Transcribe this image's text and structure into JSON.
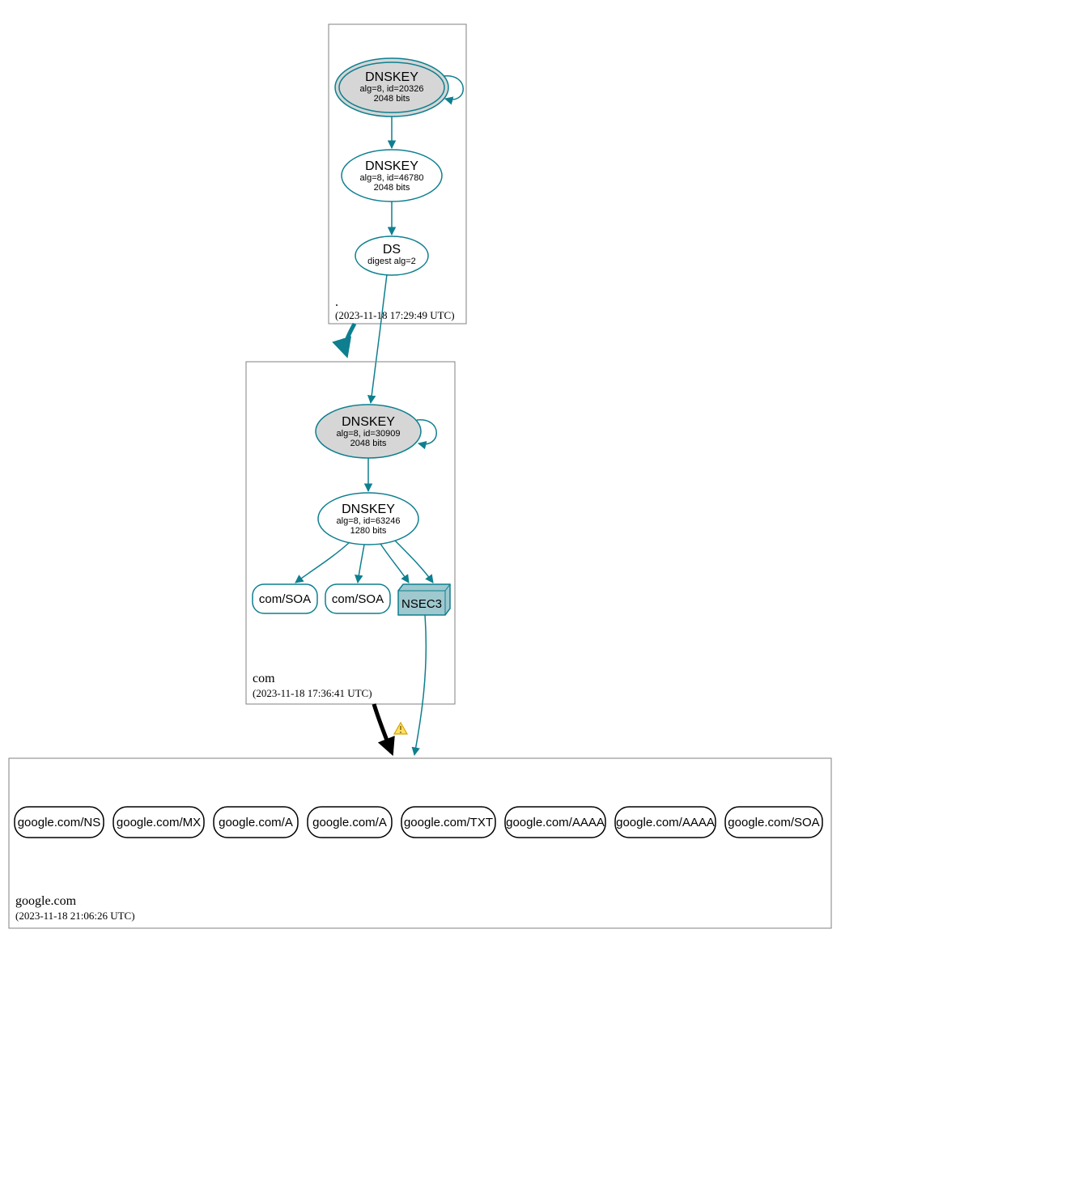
{
  "colors": {
    "teal": "#0e7f8f",
    "node_fill_gray": "#d6d6d6",
    "nsec3_fill": "#9fc8cf",
    "warn_outline": "#d6a500",
    "warn_fill": "#ffe066"
  },
  "zones": [
    {
      "name": ".",
      "timestamp": "(2023-11-18 17:29:49 UTC)",
      "nodes": {
        "ksk": {
          "title": "DNSKEY",
          "line1": "alg=8, id=20326",
          "line2": "2048 bits"
        },
        "zsk": {
          "title": "DNSKEY",
          "line1": "alg=8, id=46780",
          "line2": "2048 bits"
        },
        "ds": {
          "title": "DS",
          "line1": "digest alg=2"
        }
      }
    },
    {
      "name": "com",
      "timestamp": "(2023-11-18 17:36:41 UTC)",
      "nodes": {
        "ksk": {
          "title": "DNSKEY",
          "line1": "alg=8, id=30909",
          "line2": "2048 bits"
        },
        "zsk": {
          "title": "DNSKEY",
          "line1": "alg=8, id=63246",
          "line2": "1280 bits"
        },
        "leaves": {
          "soa1": "com/SOA",
          "soa2": "com/SOA",
          "nsec3": "NSEC3"
        }
      }
    },
    {
      "name": "google.com",
      "timestamp": "(2023-11-18 21:06:26 UTC)",
      "records": [
        "google.com/NS",
        "google.com/MX",
        "google.com/A",
        "google.com/A",
        "google.com/TXT",
        "google.com/AAAA",
        "google.com/AAAA",
        "google.com/SOA"
      ]
    }
  ]
}
